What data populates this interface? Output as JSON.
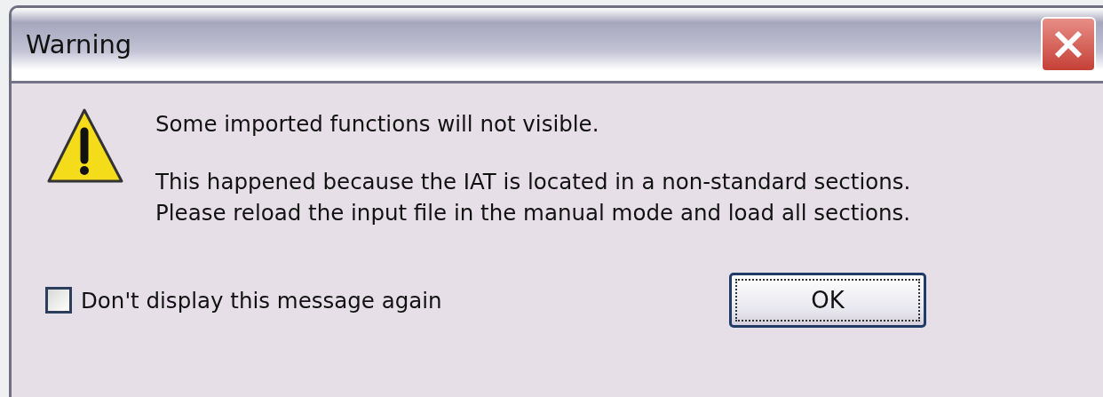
{
  "window": {
    "title": "Warning"
  },
  "message": {
    "lines": [
      "Some imported functions will not visible.",
      "This happened because the IAT is located in a non-standard sections.\nPlease reload the input file in the manual mode and load all sections."
    ]
  },
  "checkbox": {
    "label": "Don't display this message again",
    "checked": false
  },
  "buttons": [
    {
      "label": "OK",
      "focused": true
    }
  ]
}
